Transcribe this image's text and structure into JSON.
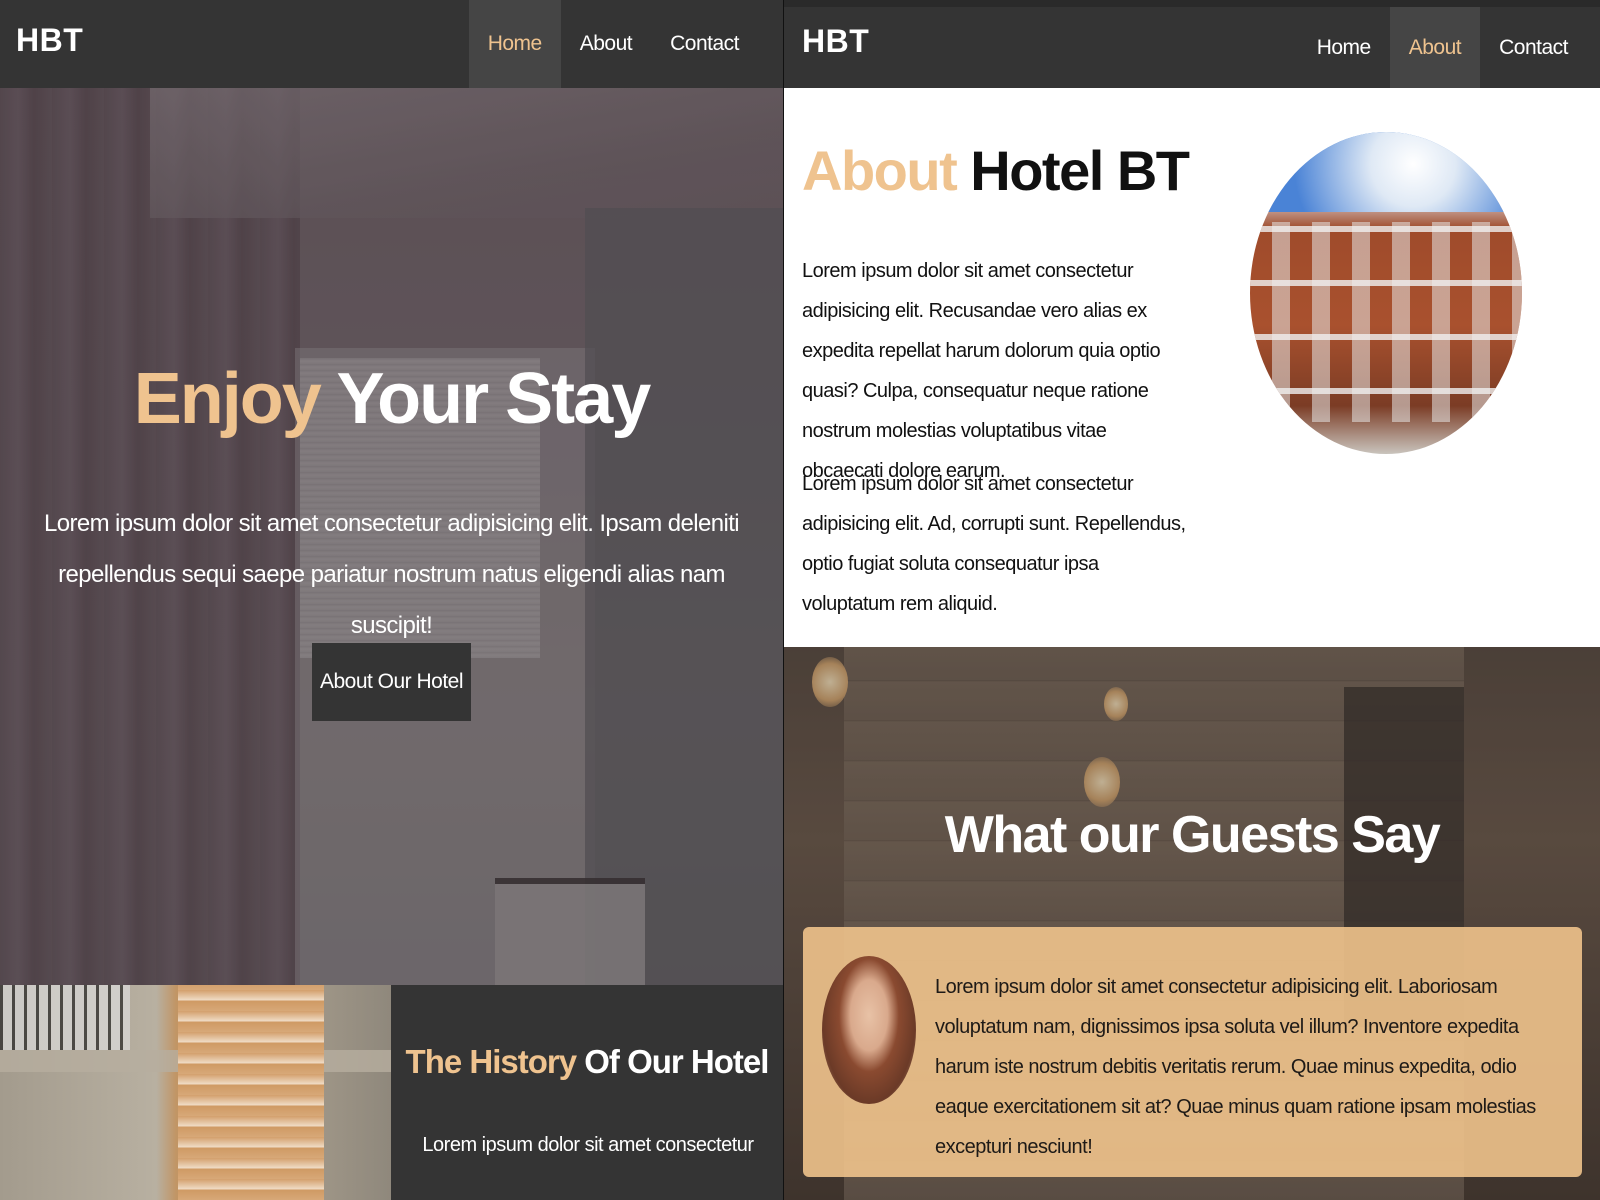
{
  "left_window": {
    "navbar": {
      "brand": "HBT",
      "links": [
        {
          "label": "Home",
          "active": true
        },
        {
          "label": "About",
          "active": false
        },
        {
          "label": "Contact",
          "active": false
        }
      ]
    },
    "hero": {
      "title_accent": "Enjoy",
      "title_rest": "Your Stay",
      "text": "Lorem ipsum dolor sit amet consectetur adipisicing elit. Ipsam deleniti repellendus sequi saepe pariatur nostrum natus eligendi alias nam suscipit!",
      "button_label": "About Our Hotel"
    },
    "history": {
      "title_accent": "The History",
      "title_rest": "Of Our Hotel",
      "text": "Lorem ipsum dolor sit amet consectetur"
    }
  },
  "right_window": {
    "navbar": {
      "brand": "HBT",
      "links": [
        {
          "label": "Home",
          "active": false
        },
        {
          "label": "About",
          "active": true
        },
        {
          "label": "Contact",
          "active": false
        }
      ]
    },
    "about": {
      "title_accent": "About",
      "title_rest": "Hotel BT",
      "paragraph_1": "Lorem ipsum dolor sit amet consectetur adipisicing elit. Recusandae vero alias ex expedita repellat harum dolorum quia optio quasi? Culpa, consequatur neque ratione nostrum molestias voluptatibus vitae obcaecati dolore earum.",
      "paragraph_2": "Lorem ipsum dolor sit amet consectetur adipisicing elit. Ad, corrupti sunt. Repellendus, optio fugiat soluta consequatur ipsa voluptatum rem aliquid."
    },
    "guests": {
      "title": "What our Guests Say",
      "testimonial_text": "Lorem ipsum dolor sit amet consectetur adipisicing elit. Laboriosam voluptatum nam, dignissimos ipsa soluta vel illum? Inventore expedita harum iste nostrum debitis veritatis rerum. Quae minus expedita, odio eaque exercitationem sit at? Quae minus quam ratione ipsam molestias excepturi nesciunt!"
    }
  },
  "colors": {
    "accent": "#efc38f",
    "navbar": "#343434",
    "nav_active_bg": "#454545",
    "testimonial_card": "#f0c38c"
  }
}
